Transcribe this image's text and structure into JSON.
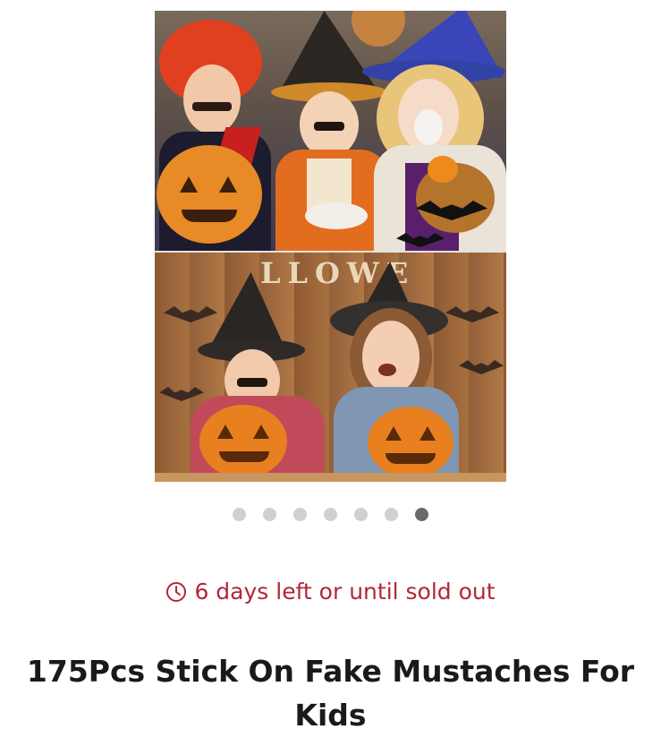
{
  "product": {
    "image": {
      "alt": "Kids in Halloween costumes wearing stick on fake mustaches with carved pumpkins",
      "banner_text": "LLOWE"
    },
    "carousel": {
      "total": 7,
      "active_index": 6
    },
    "timer": {
      "icon": "clock-icon",
      "text": "6 days left or until sold out",
      "color": "#b3263a"
    },
    "title": "175Pcs Stick On Fake Mustaches For Kids"
  }
}
